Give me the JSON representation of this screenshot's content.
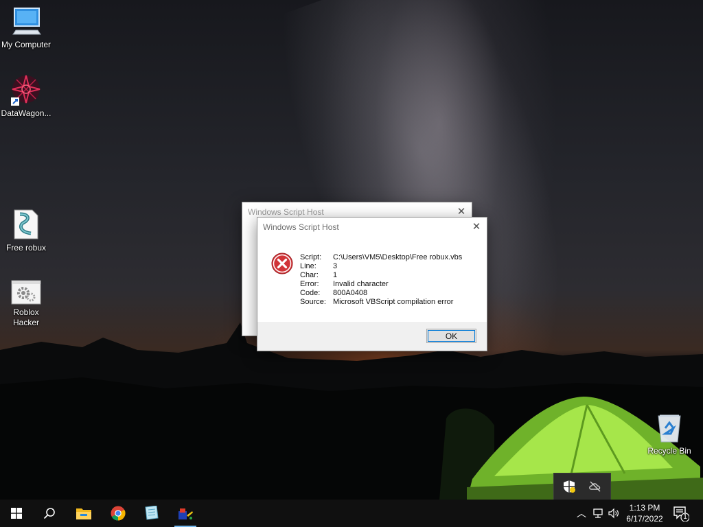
{
  "desktop": {
    "icons": [
      {
        "label": "My Computer",
        "icon": "computer-icon"
      },
      {
        "label": "DataWagon...",
        "icon": "datawagon-shortcut-icon"
      },
      {
        "label": "Free robux",
        "icon": "vbs-script-icon"
      },
      {
        "label": "Roblox\nHacker",
        "icon": "settings-gears-icon"
      },
      {
        "label": "Recycle Bin",
        "icon": "recycle-bin-icon"
      }
    ]
  },
  "dialog_back": {
    "title": "Windows Script Host"
  },
  "dialog_front": {
    "title": "Windows Script Host",
    "rows": [
      {
        "key": "Script:",
        "value": "C:\\Users\\VM5\\Desktop\\Free robux.vbs"
      },
      {
        "key": "Line:",
        "value": "3"
      },
      {
        "key": "Char:",
        "value": "1"
      },
      {
        "key": "Error:",
        "value": "Invalid character"
      },
      {
        "key": "Code:",
        "value": "800A0408"
      },
      {
        "key": "Source:",
        "value": "Microsoft VBScript compilation error"
      }
    ],
    "ok_label": "OK",
    "error_color": "#d13438"
  },
  "taskbar": {
    "apps": [
      "start-icon",
      "search-icon",
      "file-explorer-icon",
      "chrome-icon",
      "notepad-icon",
      "paint-icon"
    ],
    "time": "1:13 PM",
    "date": "6/17/2022",
    "notification_count": "1"
  },
  "colors": {
    "taskbar": "#101010",
    "accent": "#0078d7",
    "tent": "#8fdc3a"
  }
}
